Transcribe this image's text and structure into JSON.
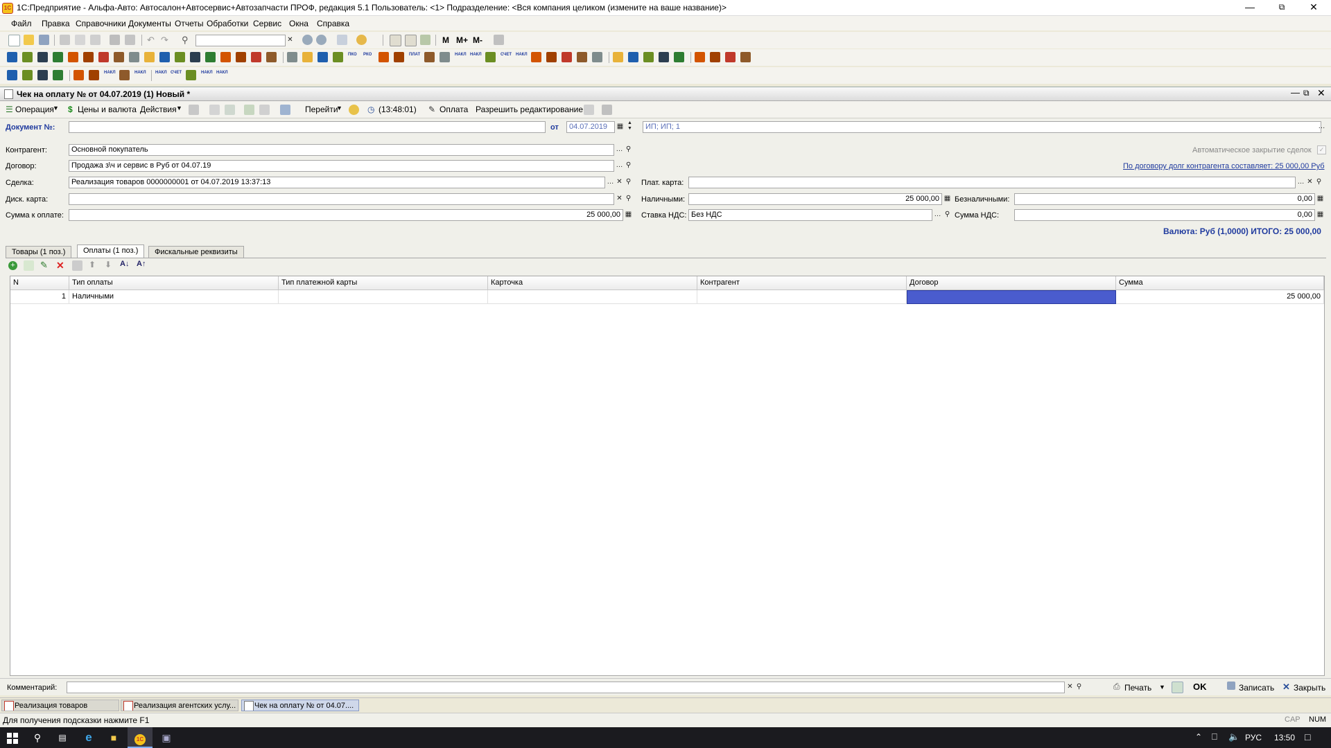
{
  "window": {
    "title": "1С:Предприятие - Альфа-Авто: Автосалон+Автосервис+Автозапчасти ПРОФ, редакция 5.1    Пользователь: <1>    Подразделение: <Вся компания целиком (измените на ваше название)>",
    "logo_text": "1С"
  },
  "menu": [
    "Файл",
    "Правка",
    "Справочники",
    "Документы",
    "Отчеты",
    "Обработки",
    "Сервис",
    "Окна",
    "Справка"
  ],
  "toolbar": {
    "m": "M",
    "m_plus": "M+",
    "m_minus": "M-",
    "icon_labels": [
      "ПКО",
      "РКО",
      "ПЛАТ",
      "НАКЛ",
      "НАКЛ",
      "СЧЕТ",
      "НАКЛ",
      "НАКЛ",
      "НАКЛ",
      "НАКЛ",
      "СЧЕТ",
      "НАКЛ",
      "НАКЛ"
    ]
  },
  "document": {
    "title": "Чек на оплату №  от 04.07.2019 (1) Новый *",
    "toolbar": {
      "operation": "Операция",
      "prices": "Цены и валюта",
      "actions": "Действия",
      "goto": "Перейти",
      "time": "(13:48:01)",
      "payment": "Оплата",
      "allow_edit": "Разрешить редактирование"
    },
    "header": {
      "doc_no_label": "Документ №:",
      "doc_no_value": "",
      "from_label": "от",
      "date_value": "04.07.2019",
      "org_value": "ИП; ИП; 1"
    },
    "fields": {
      "counterparty_label": "Контрагент:",
      "counterparty_value": "Основной покупатель",
      "contract_label": "Договор:",
      "contract_value": "Продажа з\\ч и сервис в Руб от 04.07.19",
      "deal_label": "Сделка:",
      "deal_value": "Реализация товаров 0000000001 от 04.07.2019 13:37:13",
      "disc_card_label": "Диск. карта:",
      "disc_card_value": "",
      "sum_label": "Сумма к оплате:",
      "sum_value": "25 000,00",
      "auto_close_label": "Автоматическое закрытие сделок",
      "debt_link": "По договору долг контрагента составляет: 25 000,00 Руб",
      "pay_card_label": "Плат. карта:",
      "pay_card_value": "",
      "cash_label": "Наличными:",
      "cash_value": "25 000,00",
      "noncash_label": "Безналичными:",
      "noncash_value": "0,00",
      "vat_rate_label": "Ставка НДС:",
      "vat_rate_value": "Без НДС",
      "vat_sum_label": "Сумма НДС:",
      "vat_sum_value": "0,00",
      "currency_total": "Валюта: Руб (1,0000) ИТОГО: 25 000,00"
    },
    "tabs": [
      "Товары (1 поз.)",
      "Оплаты (1 поз.)",
      "Фискальные реквизиты"
    ],
    "table": {
      "columns": [
        "N",
        "Тип оплаты",
        "Тип платежной карты",
        "Карточка",
        "Контрагент",
        "Договор",
        "Сумма"
      ],
      "rows": [
        {
          "n": "1",
          "type": "Наличными",
          "card_type": "",
          "card": "",
          "counterparty": "",
          "contract": "",
          "sum": "25 000,00"
        }
      ]
    },
    "bottom": {
      "comment_label": "Комментарий:",
      "comment_value": "",
      "print": "Печать",
      "ok": "OK",
      "save": "Записать",
      "close": "Закрыть"
    }
  },
  "window_tabs": [
    "Реализация товаров",
    "Реализация агентских услу...",
    "Чек на оплату №  от 04.07...."
  ],
  "status": {
    "hint": "Для получения подсказки нажмите F1",
    "cap": "CAP",
    "num": "NUM"
  },
  "taskbar": {
    "lang": "РУС",
    "time": "13:50"
  },
  "colors": {
    "selection": "#4a5cce",
    "link": "#1f3a9e",
    "total": "#1f3a9e"
  }
}
